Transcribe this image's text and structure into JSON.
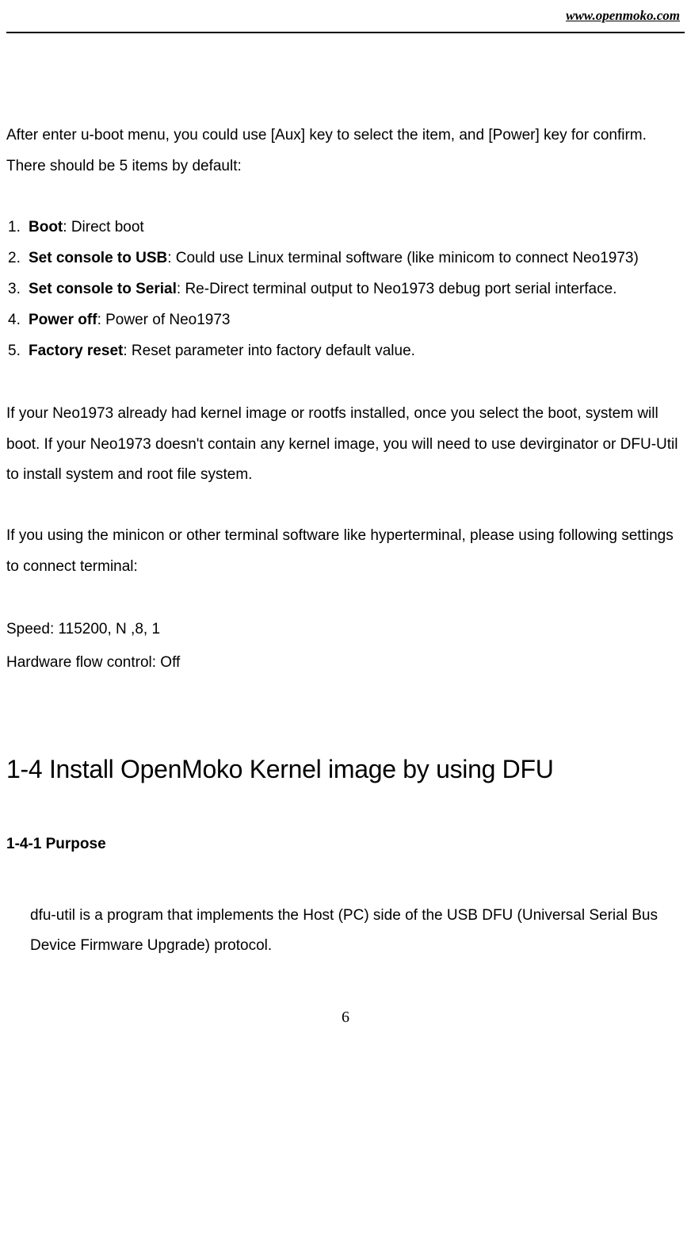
{
  "header": {
    "url": "www.openmoko.com"
  },
  "intro": "After enter u-boot menu, you could use [Aux] key to select the item, and [Power] key for confirm. There should be 5 items by default:",
  "list": [
    {
      "num": "1.",
      "title": "Boot",
      "desc": ": Direct boot"
    },
    {
      "num": "2.",
      "title": "Set console to USB",
      "desc": ": Could use Linux terminal software (like minicom to connect Neo1973)"
    },
    {
      "num": "3.",
      "title": "Set console to Serial",
      "desc": ": Re-Direct terminal output to Neo1973 debug port serial interface."
    },
    {
      "num": "4.",
      "title": "Power off",
      "desc": ": Power of Neo1973"
    },
    {
      "num": "5.",
      "title": "Factory reset",
      "desc": ": Reset parameter into factory default value."
    }
  ],
  "para2": "If your Neo1973 already had kernel image or rootfs installed, once you select the boot, system will boot. If your Neo1973 doesn't contain any kernel image, you will need to use devirginator or DFU-Util to install system and root file system.",
  "para3": "If you using the minicon or other terminal software like hyperterminal, please using following settings to connect terminal:",
  "settings": {
    "speed": "Speed: 115200, N ,8, 1",
    "flow": "Hardware flow control: Off"
  },
  "section": {
    "title": "1-4 Install OpenMoko Kernel image by using DFU",
    "sub": "1-4-1 Purpose",
    "body": "dfu-util is a program that implements the Host (PC) side of the USB DFU (Universal Serial Bus Device Firmware Upgrade) protocol."
  },
  "page_number": "6"
}
